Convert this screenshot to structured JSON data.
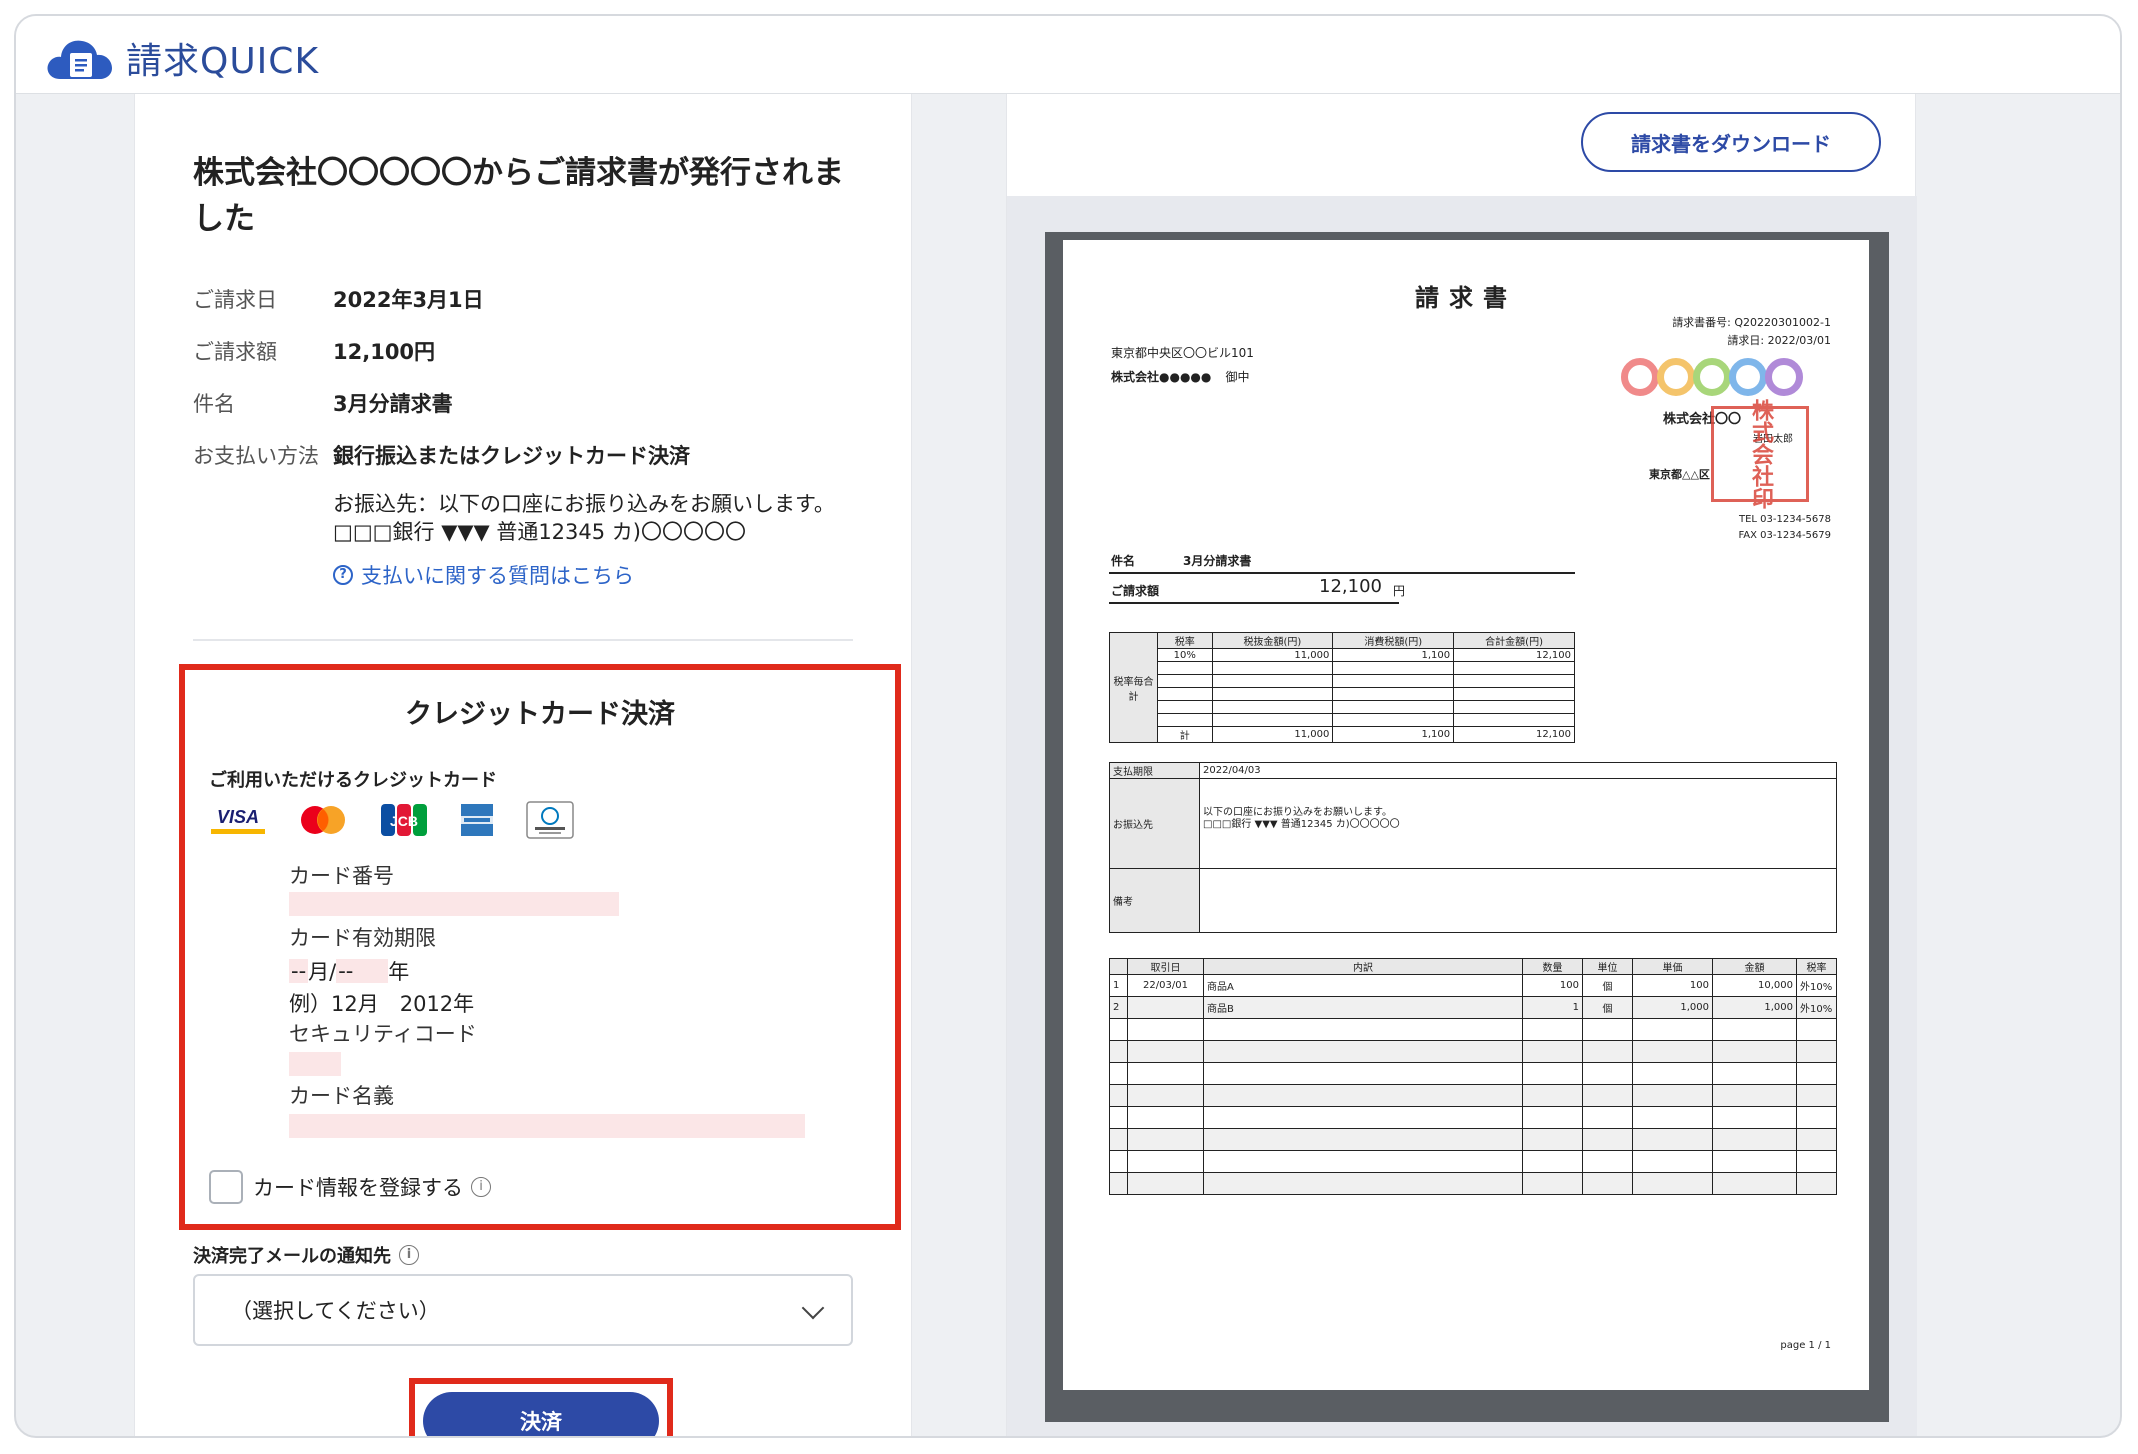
{
  "app": {
    "logo_text": "請求QUICK"
  },
  "left": {
    "title": "株式会社〇〇〇〇〇からご請求書が発行されました",
    "info": [
      {
        "label": "ご請求日",
        "value": "2022年3月1日"
      },
      {
        "label": "ご請求額",
        "value": "12,100円"
      },
      {
        "label": "件名",
        "value": "3月分請求書"
      },
      {
        "label": "お支払い方法",
        "value": "銀行振込またはクレジットカード決済"
      }
    ],
    "transfer_line1": "お振込先：以下の口座にお振り込みをお願いします。",
    "transfer_line2": "□□□銀行 ▼▼▼ 普通12345 カ)〇〇〇〇〇",
    "help_link": "支払いに関する質問はこちら",
    "help_icon_glyph": "?",
    "credit": {
      "title": "クレジットカード決済",
      "available_label": "ご利用いただけるクレジットカード",
      "brands": [
        "VISA",
        "Mastercard",
        "JCB",
        "AMERICAN EXPRESS",
        "Diners Club"
      ],
      "card_number_label": "カード番号",
      "expiry_label": "カード有効期限",
      "expiry_month": "--",
      "expiry_month_unit": "月/",
      "expiry_year": "--",
      "expiry_year_unit": "年",
      "expiry_example": "例）12月　2012年",
      "security_label": "セキュリティコード",
      "name_label": "カード名義",
      "save_label": "カード情報を登録する"
    },
    "notify_label": "決済完了メールの通知先",
    "info_glyph": "i",
    "notify_select": "（選択してください）",
    "pay_button": "決済"
  },
  "right": {
    "download_button": "請求書をダウンロード",
    "invoice": {
      "title": "請求書",
      "number": "請求書番号: Q20220301002-1",
      "date": "請求日: 2022/03/01",
      "to_address": "東京都中央区〇〇ビル101",
      "to_company": "株式会社●●●●●",
      "to_suffix": "御中",
      "from_company": "株式会社〇〇",
      "from_person": "岩田太郎",
      "from_address": "東京都△△区",
      "tel": "TEL 03-1234-5678",
      "fax": "FAX 03-1234-5679",
      "stamp_text": "株式会社印",
      "subject_label": "件名",
      "subject": "3月分請求書",
      "amount_label": "ご請求額",
      "amount": "12,100",
      "amount_unit": "円",
      "tax_table": {
        "side_label": "税率毎合計",
        "headers": [
          "税率",
          "税抜金額(円)",
          "消費税額(円)",
          "合計金額(円)"
        ],
        "row": [
          "10%",
          "11,000",
          "1,100",
          "12,100"
        ],
        "total_label": "計",
        "total": [
          "11,000",
          "1,100",
          "12,100"
        ]
      },
      "due_label": "支払期限",
      "due": "2022/04/03",
      "bank_label": "お振込先",
      "bank_line1": "以下の口座にお振り込みをお願いします。",
      "bank_line2": "□□□銀行 ▼▼▼ 普通12345 カ)〇〇〇〇〇",
      "note_label": "備考",
      "items_headers": [
        "取引日",
        "内訳",
        "数量",
        "単位",
        "単価",
        "金額",
        "税率"
      ],
      "items": [
        {
          "no": "1",
          "date": "22/03/01",
          "desc": "商品A",
          "qty": "100",
          "unit": "個",
          "price": "100",
          "amount": "10,000",
          "tax": "外10%"
        },
        {
          "no": "2",
          "date": "",
          "desc": "商品B",
          "qty": "1",
          "unit": "個",
          "price": "1,000",
          "amount": "1,000",
          "tax": "外10%"
        }
      ],
      "page": "page 1 / 1"
    }
  },
  "colors": {
    "accent": "#2d4aa6",
    "highlight": "#e02a1b",
    "input_bg": "#fbe6e7",
    "link": "#2d64c8"
  }
}
